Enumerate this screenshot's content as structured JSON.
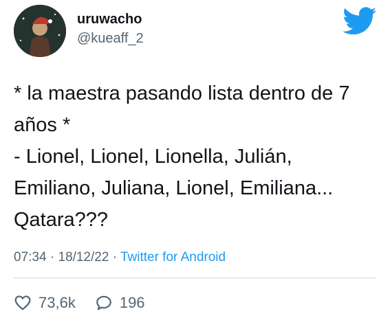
{
  "tweet": {
    "display_name": "uruwacho",
    "handle": "@kueaff_2",
    "text": "* la maestra pasando lista dentro de 7\naños *\n- Lionel, Lionel, Lionella, Julián,\nEmiliano, Juliana, Lionel, Emiliana...\nQatara???",
    "time": "07:34",
    "date": "18/12/22",
    "separator": "·",
    "source": "Twitter for Android",
    "likes": "73,6k",
    "replies": "196"
  },
  "icons": {
    "logo": "twitter-bird-icon",
    "like": "heart-icon",
    "reply": "reply-bubble-icon"
  },
  "colors": {
    "brand": "#1d9bf0",
    "text": "#0f1419",
    "muted": "#536471",
    "divider": "#cfd9de"
  }
}
